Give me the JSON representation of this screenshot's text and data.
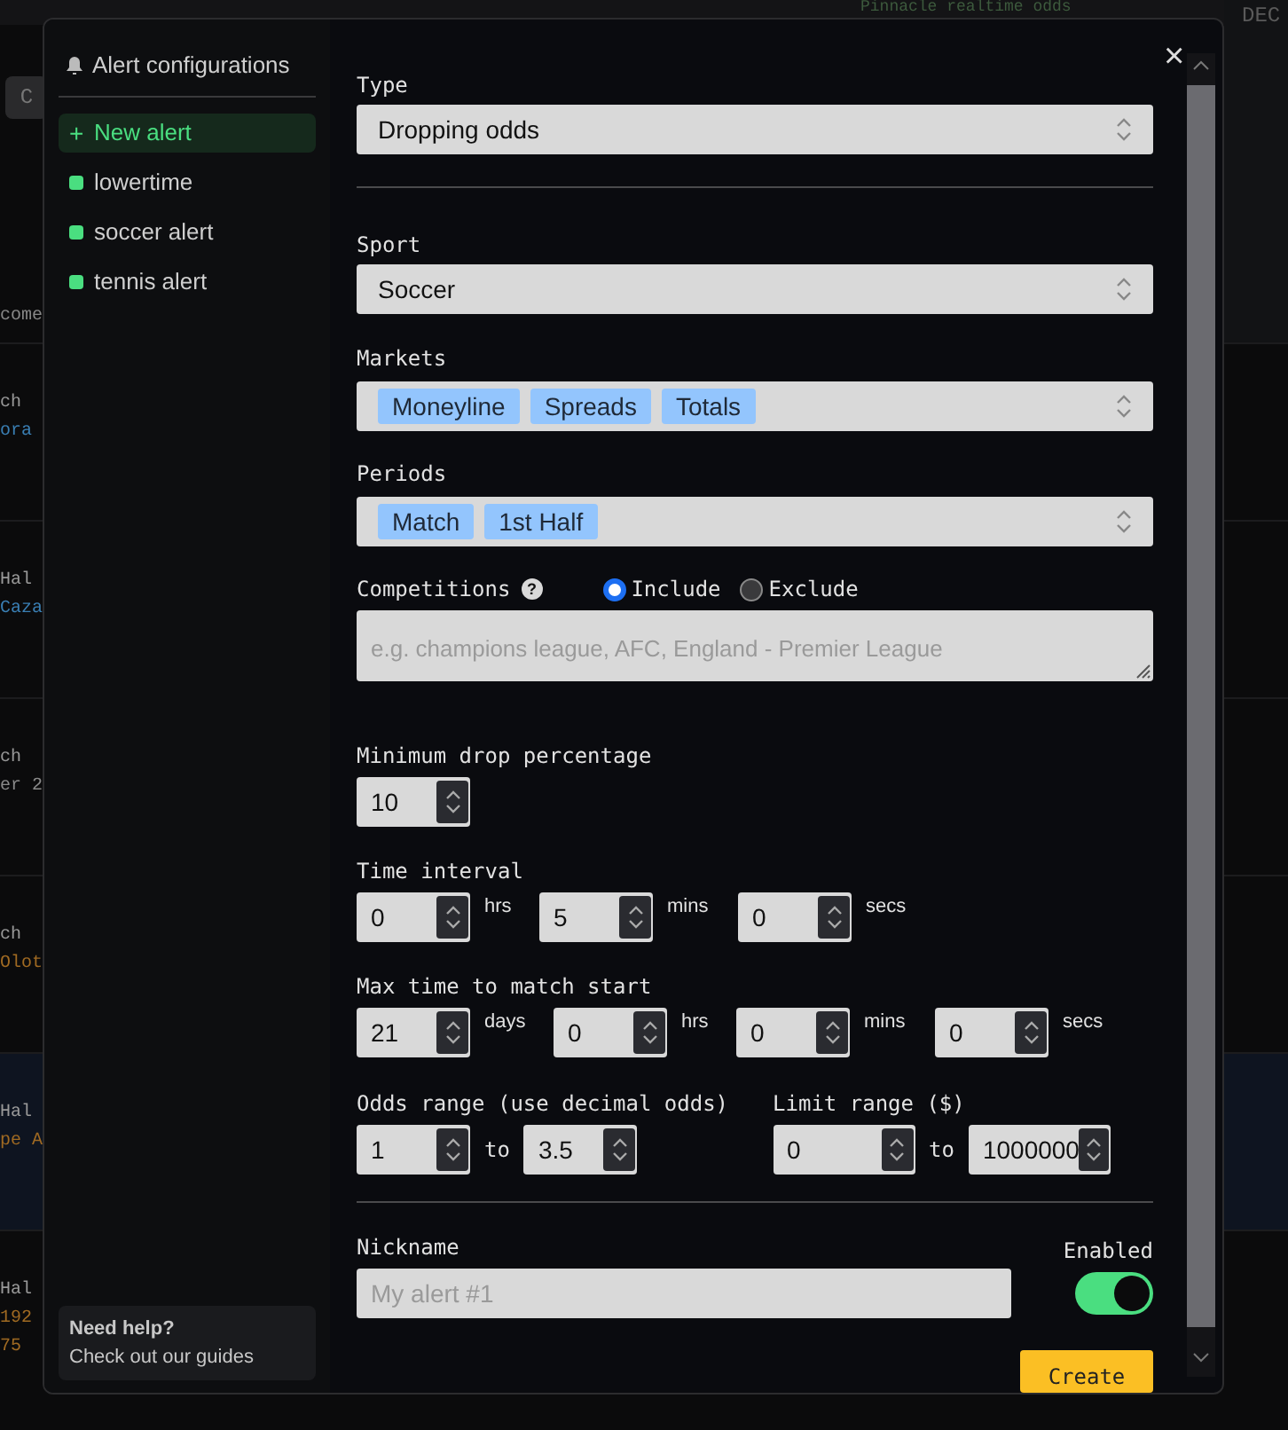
{
  "background": {
    "header_text": "Pinnacle realtime odds",
    "corner_label": "DEC",
    "button_label": "C",
    "column_heading": "come",
    "rows": [
      {
        "lines": [
          "ch",
          "ora"
        ],
        "color": "#3a7fb4",
        "highlighted": false
      },
      {
        "lines": [
          "Hal",
          "Caza"
        ],
        "color": "#3a7fb4",
        "highlighted": false
      },
      {
        "lines": [
          "ch",
          "er 2"
        ],
        "color": "#8a8a8a",
        "highlighted": false
      },
      {
        "lines": [
          "ch",
          "Olot"
        ],
        "color": "#a06a22",
        "highlighted": false
      },
      {
        "lines": [
          "Hal",
          "pe A"
        ],
        "color": "#a06a22",
        "highlighted": true
      },
      {
        "lines": [
          "Hal",
          "192",
          "75"
        ],
        "color": "#a06a22",
        "highlighted": false
      }
    ]
  },
  "sidebar": {
    "title": "Alert configurations",
    "items": [
      {
        "kind": "new",
        "icon": "+",
        "label": "New alert",
        "selected": true
      },
      {
        "kind": "alert",
        "label": "lowertime",
        "selected": false,
        "enabled": true
      },
      {
        "kind": "alert",
        "label": "soccer alert",
        "selected": false,
        "enabled": true
      },
      {
        "kind": "alert",
        "label": "tennis alert",
        "selected": false,
        "enabled": true
      }
    ],
    "help": {
      "title": "Need help?",
      "link": "Check out our guides"
    }
  },
  "form": {
    "close": "×",
    "type": {
      "label": "Type",
      "value": "Dropping odds"
    },
    "sport": {
      "label": "Sport",
      "value": "Soccer"
    },
    "markets": {
      "label": "Markets",
      "tags": [
        "Moneyline",
        "Spreads",
        "Totals"
      ]
    },
    "periods": {
      "label": "Periods",
      "tags": [
        "Match",
        "1st Half"
      ]
    },
    "competitions": {
      "label": "Competitions",
      "help": "?",
      "options": [
        {
          "label": "Include",
          "selected": true
        },
        {
          "label": "Exclude",
          "selected": false
        }
      ],
      "placeholder": "e.g. champions league, AFC, England - Premier League"
    },
    "min_drop": {
      "label": "Minimum drop percentage",
      "value": "10"
    },
    "time_interval": {
      "label": "Time interval",
      "fields": [
        {
          "value": "0",
          "unit": "hrs"
        },
        {
          "value": "5",
          "unit": "mins"
        },
        {
          "value": "0",
          "unit": "secs"
        }
      ]
    },
    "max_time": {
      "label": "Max time to match start",
      "fields": [
        {
          "value": "21",
          "unit": "days"
        },
        {
          "value": "0",
          "unit": "hrs"
        },
        {
          "value": "0",
          "unit": "mins"
        },
        {
          "value": "0",
          "unit": "secs"
        }
      ]
    },
    "odds_range": {
      "label": "Odds range (use decimal odds)",
      "from": "1",
      "separator": "to",
      "to": "3.5"
    },
    "limit_range": {
      "label": "Limit range ($)",
      "from": "0",
      "separator": "to",
      "to": "1000000"
    },
    "nickname": {
      "label": "Nickname",
      "placeholder": "My alert #1"
    },
    "enabled": {
      "label": "Enabled",
      "on": true
    },
    "create_button": "Create"
  }
}
